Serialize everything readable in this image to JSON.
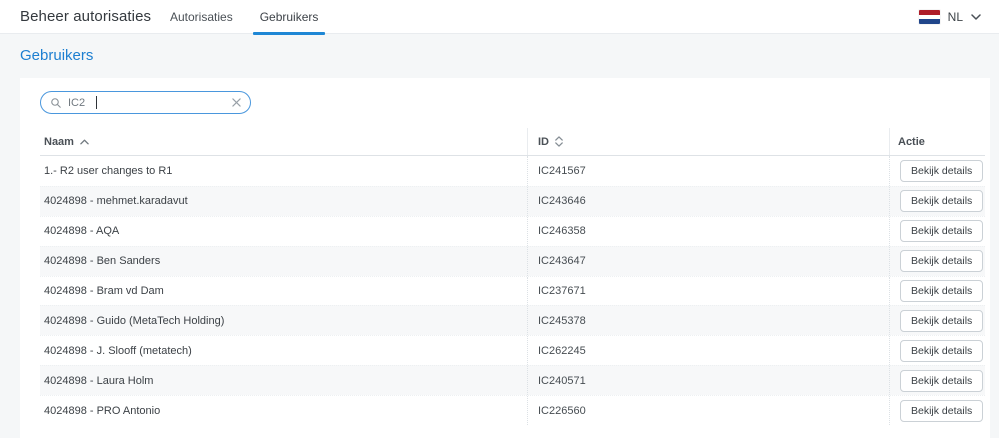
{
  "colors": {
    "accent_blue": "#1e87d5",
    "heading_blue": "#1d7fd1",
    "search_border": "#4a97dd",
    "flag_red": "#AE1C28",
    "flag_white": "#FFFFFF",
    "flag_blue": "#21468B"
  },
  "header": {
    "title": "Beheer autorisaties",
    "tabs": [
      {
        "label": "Autorisaties",
        "active": false
      },
      {
        "label": "Gebruikers",
        "active": true
      }
    ],
    "language": {
      "code": "NL"
    }
  },
  "page": {
    "heading": "Gebruikers"
  },
  "search": {
    "value": "IC2"
  },
  "table": {
    "columns": {
      "naam": {
        "label": "Naam",
        "sort": "ascending"
      },
      "id": {
        "label": "ID",
        "sort": "none"
      },
      "actie": {
        "label": "Actie"
      }
    },
    "action_label": "Bekijk details",
    "rows": [
      {
        "naam": "1.- R2 user changes to R1",
        "id": "IC241567"
      },
      {
        "naam": "4024898 - mehmet.karadavut",
        "id": "IC243646"
      },
      {
        "naam": "4024898 - AQA",
        "id": "IC246358"
      },
      {
        "naam": "4024898 - Ben Sanders",
        "id": "IC243647"
      },
      {
        "naam": "4024898 - Bram vd Dam",
        "id": "IC237671"
      },
      {
        "naam": "4024898 - Guido (MetaTech Holding)",
        "id": "IC245378"
      },
      {
        "naam": "4024898 - J. Slooff (metatech)",
        "id": "IC262245"
      },
      {
        "naam": "4024898 - Laura Holm",
        "id": "IC240571"
      },
      {
        "naam": "4024898 - PRO Antonio",
        "id": "IC226560"
      }
    ]
  }
}
